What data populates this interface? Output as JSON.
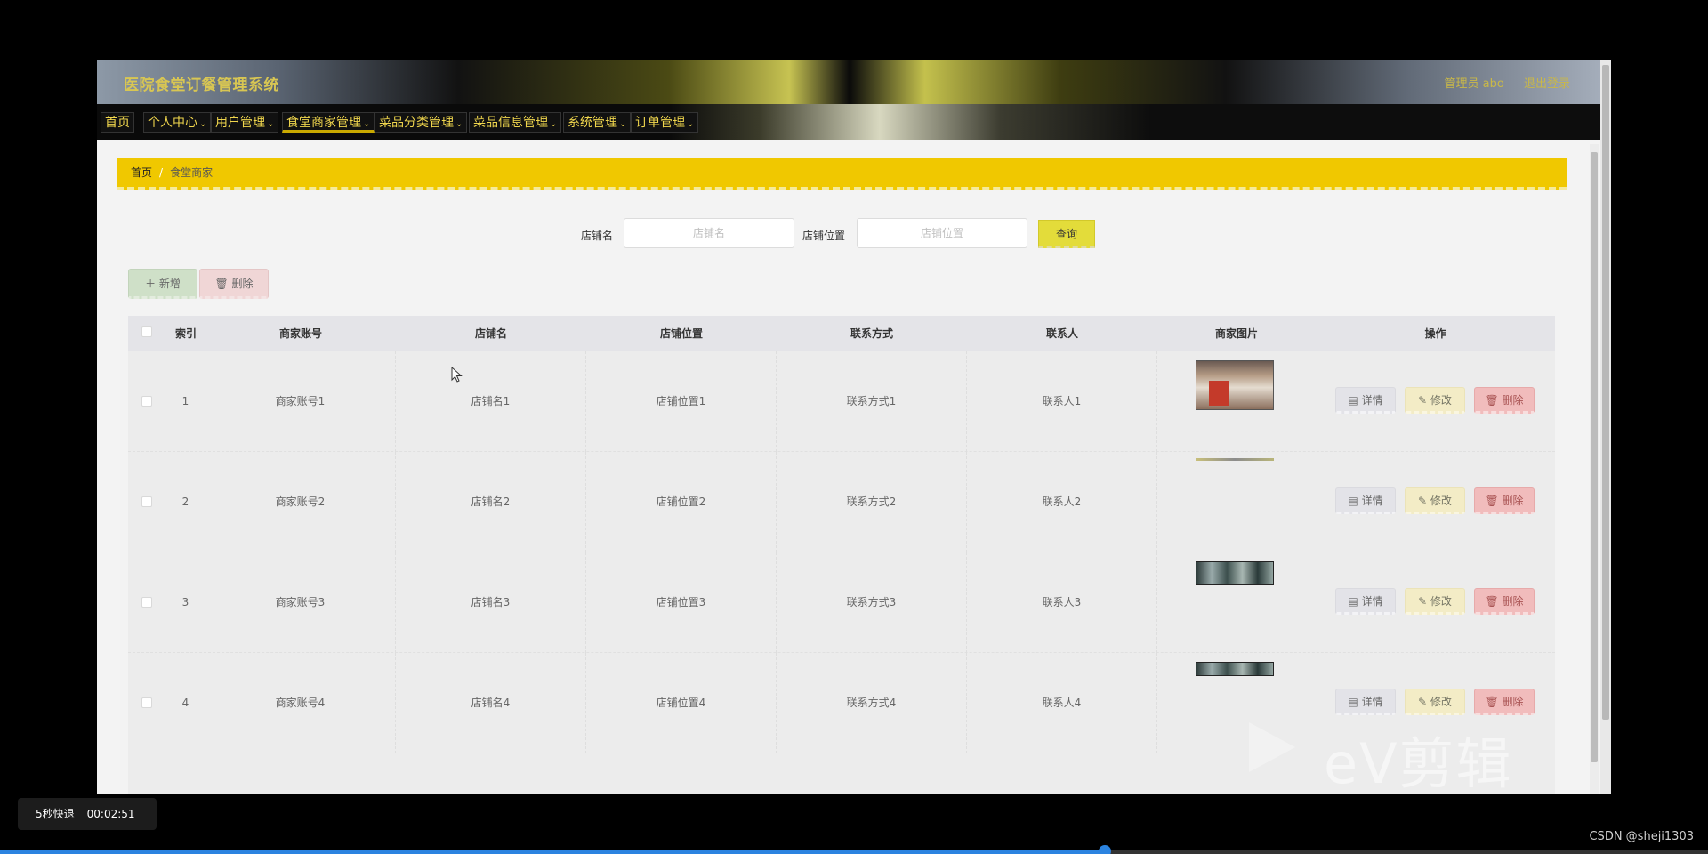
{
  "app": {
    "title": "医院食堂订餐管理系统",
    "user_label": "管理员 abo",
    "logout_label": "退出登录"
  },
  "nav": [
    {
      "label": "首页"
    },
    {
      "label": "个人中心"
    },
    {
      "label": "用户管理"
    },
    {
      "label": "食堂商家管理"
    },
    {
      "label": "菜品分类管理"
    },
    {
      "label": "菜品信息管理"
    },
    {
      "label": "系统管理"
    },
    {
      "label": "订单管理"
    }
  ],
  "breadcrumb": {
    "home": "首页",
    "sep": "/",
    "current": "食堂商家"
  },
  "search": {
    "shop_name_label": "店铺名",
    "shop_name_placeholder": "店铺名",
    "shop_location_label": "店铺位置",
    "shop_location_placeholder": "店铺位置",
    "query_label": "查询"
  },
  "actions": {
    "add_label": "＋ 新增",
    "delete_label": "🗑 删除"
  },
  "table": {
    "columns": [
      "索引",
      "商家账号",
      "店铺名",
      "店铺位置",
      "联系方式",
      "联系人",
      "商家图片",
      "操作"
    ],
    "rows": [
      {
        "index": "1",
        "account": "商家账号1",
        "shop": "店铺名1",
        "location": "店铺位置1",
        "contact": "联系方式1",
        "person": "联系人1"
      },
      {
        "index": "2",
        "account": "商家账号2",
        "shop": "店铺名2",
        "location": "店铺位置2",
        "contact": "联系方式2",
        "person": "联系人2"
      },
      {
        "index": "3",
        "account": "商家账号3",
        "shop": "店铺名3",
        "location": "店铺位置3",
        "contact": "联系方式3",
        "person": "联系人3"
      },
      {
        "index": "4",
        "account": "商家账号4",
        "shop": "店铺名4",
        "location": "店铺位置4",
        "contact": "联系方式4",
        "person": "联系人4"
      }
    ],
    "op_detail": "详情",
    "op_edit": "修改",
    "op_delete": "删除"
  },
  "overlay": {
    "speed_label": "5秒快退",
    "time": "00:02:51",
    "watermark": "eV剪辑",
    "credit": "CSDN @sheji1303",
    "progress": 0.647
  },
  "colors": {
    "accent_yellow": "#f0c800",
    "nav_text": "#f0d64d",
    "delete_red": "#f1bcbc",
    "progress_blue": "#2b83e0"
  }
}
